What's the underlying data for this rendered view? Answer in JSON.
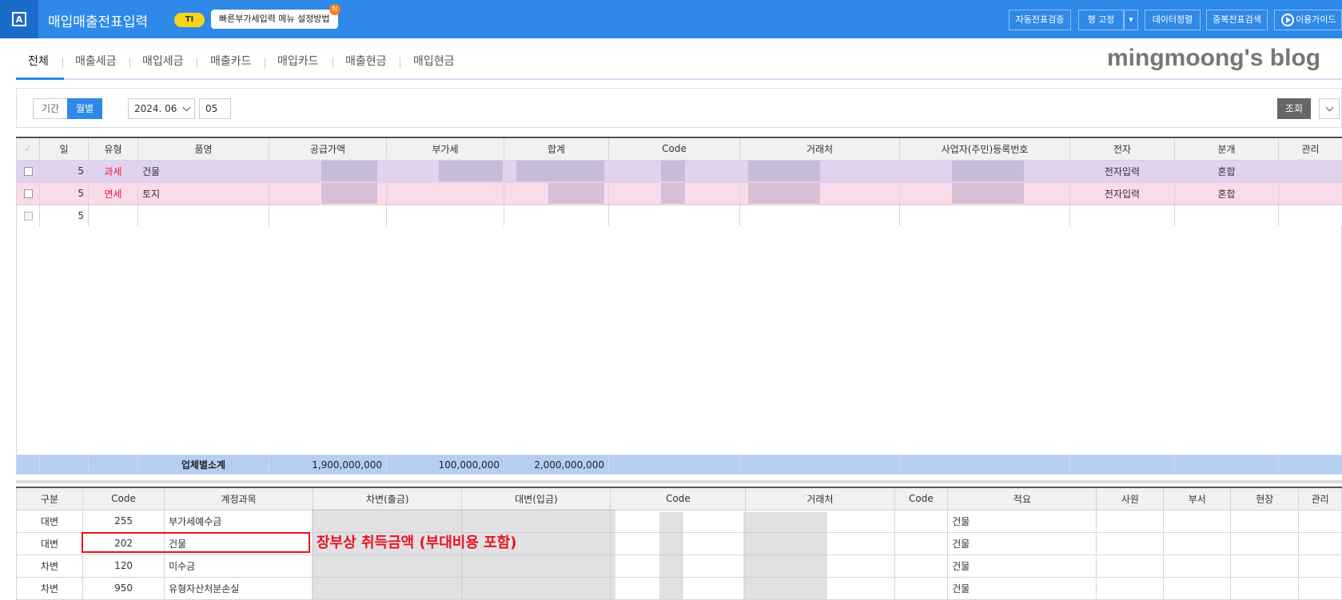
{
  "app": {
    "logo_letter": "A",
    "title": "매입매출전표입력",
    "badge": "TI",
    "tip_text": "빠른부가세입력 메뉴 설정방법",
    "tip_notice": "N"
  },
  "toolbar": {
    "auto_verify": "자동전표검증",
    "row_fix": "행 고정",
    "data_sort": "데이터정렬",
    "dup_search": "중복전표검색",
    "guide": "이용가이드"
  },
  "tabs": [
    "전체",
    "매출세금",
    "매입세금",
    "매출카드",
    "매입카드",
    "매출현금",
    "매입현금"
  ],
  "watermark": "mingmoong's blog",
  "filter": {
    "period_label": "기간",
    "monthly_label": "월별",
    "month_value": "2024. 06",
    "day_value": "05",
    "search_label": "조회"
  },
  "grid1": {
    "headers": [
      "일",
      "유형",
      "품명",
      "공급가액",
      "부가세",
      "합계",
      "Code",
      "거래처",
      "사업자(주민)등록번호",
      "전자",
      "분개",
      "관리"
    ],
    "rows": [
      {
        "day": "5",
        "type": "과세",
        "item": "건물",
        "electronic": "전자입력",
        "journal": "혼합"
      },
      {
        "day": "5",
        "type": "면세",
        "item": "토지",
        "electronic": "전자입력",
        "journal": "혼합"
      },
      {
        "day": "5",
        "type": "",
        "item": "",
        "electronic": "",
        "journal": ""
      }
    ],
    "subtotal": {
      "label": "업체별소계",
      "supply": "1,900,000,000",
      "vat": "100,000,000",
      "total": "2,000,000,000"
    }
  },
  "grid2": {
    "headers": [
      "구분",
      "Code",
      "계정과목",
      "차변(출금)",
      "대변(입금)",
      "Code",
      "거래처",
      "Code",
      "적요",
      "사원",
      "부서",
      "현장",
      "관리"
    ],
    "rows": [
      {
        "side": "대변",
        "code": "255",
        "account": "부가세예수금",
        "memo": "건물"
      },
      {
        "side": "대변",
        "code": "202",
        "account": "건물",
        "memo": "건물"
      },
      {
        "side": "차변",
        "code": "120",
        "account": "미수금",
        "memo": "건물"
      },
      {
        "side": "차변",
        "code": "950",
        "account": "유형자산처분손실",
        "memo": "건물"
      }
    ]
  },
  "annotation": "장부상 취득금액 (부대비용 포함)",
  "colors": {
    "brand_blue": "#2e89e8",
    "annotation_red": "#e8131f",
    "row_purple": "#e1d2f0",
    "row_pink": "#fbdaea",
    "subtotal_blue": "#b4cff2"
  }
}
